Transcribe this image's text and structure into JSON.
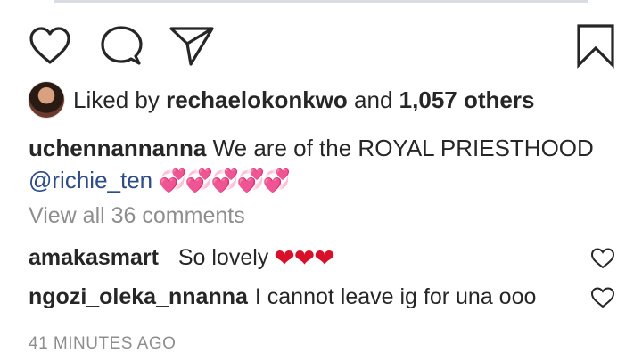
{
  "post": {
    "liked_by_prefix": "Liked by",
    "liked_by_user": "rechaelokonkwo",
    "and_text": "and",
    "others_text": "1,057 others",
    "author": "uchennannanna",
    "caption_text": "We are of the ROYAL PRIESTHOOD",
    "mention": "@richie_ten",
    "caption_emoji": "💞💞💞💞💞",
    "view_all_comments": "View all 36 comments",
    "timestamp": "41 MINUTES AGO"
  },
  "comments": [
    {
      "user": "amakasmart_",
      "text": "So lovely",
      "emoji": "❤❤❤"
    },
    {
      "user": "ngozi_oleka_nnanna",
      "text": "I cannot leave ig for una ooo",
      "emoji": ""
    }
  ],
  "colors": {
    "text": "#262626",
    "muted": "#8e8e8e",
    "mention": "#2f4c8a",
    "heart_emoji": "#d8102a"
  },
  "icons": [
    "heart-icon",
    "comment-icon",
    "share-icon",
    "bookmark-icon"
  ]
}
